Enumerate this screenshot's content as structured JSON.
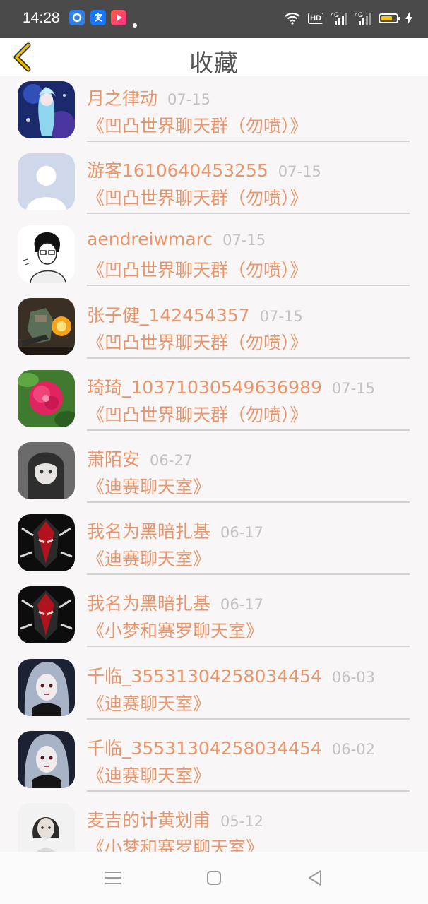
{
  "status_bar": {
    "time": "14:28",
    "hd_label": "HD",
    "network_label_1": "4G",
    "network_label_2": "4G",
    "battery_percent": 75
  },
  "header": {
    "title": "收藏",
    "back_icon": "back-chevron-icon"
  },
  "favorites": [
    {
      "name": "月之律动",
      "date": "07-15",
      "room": "《凹凸世界聊天群（勿喷）》"
    },
    {
      "name": "游客1610640453255",
      "date": "07-15",
      "room": "《凹凸世界聊天群（勿喷）》"
    },
    {
      "name": "aendreiwmarc",
      "date": "07-15",
      "room": "《凹凸世界聊天群（勿喷）》"
    },
    {
      "name": "张子健_142454357",
      "date": "07-15",
      "room": "《凹凸世界聊天群（勿喷）》"
    },
    {
      "name": "琦琦_10371030549636989",
      "date": "07-15",
      "room": "《凹凸世界聊天群（勿喷）》"
    },
    {
      "name": "萧陌安",
      "date": "06-27",
      "room": "《迪赛聊天室》"
    },
    {
      "name": "我名为黑暗扎基",
      "date": "06-17",
      "room": "《迪赛聊天室》"
    },
    {
      "name": "我名为黑暗扎基",
      "date": "06-17",
      "room": "《小梦和赛罗聊天室》"
    },
    {
      "name": "千临_35531304258034454",
      "date": "06-03",
      "room": "《迪赛聊天室》"
    },
    {
      "name": "千临_35531304258034454",
      "date": "06-02",
      "room": "《迪赛聊天室》"
    },
    {
      "name": "麦吉的计黄划甫",
      "date": "05-12",
      "room": "《小梦和赛罗聊天室》"
    }
  ],
  "nav_bar": {
    "icons": [
      "menu-icon",
      "home-square-icon",
      "back-triangle-icon"
    ]
  },
  "colors": {
    "name_text": "#e8956b",
    "date_text": "#c2c2c2",
    "status_bar_bg": "#4a4a4a",
    "back_chevron": "#f0c000"
  }
}
